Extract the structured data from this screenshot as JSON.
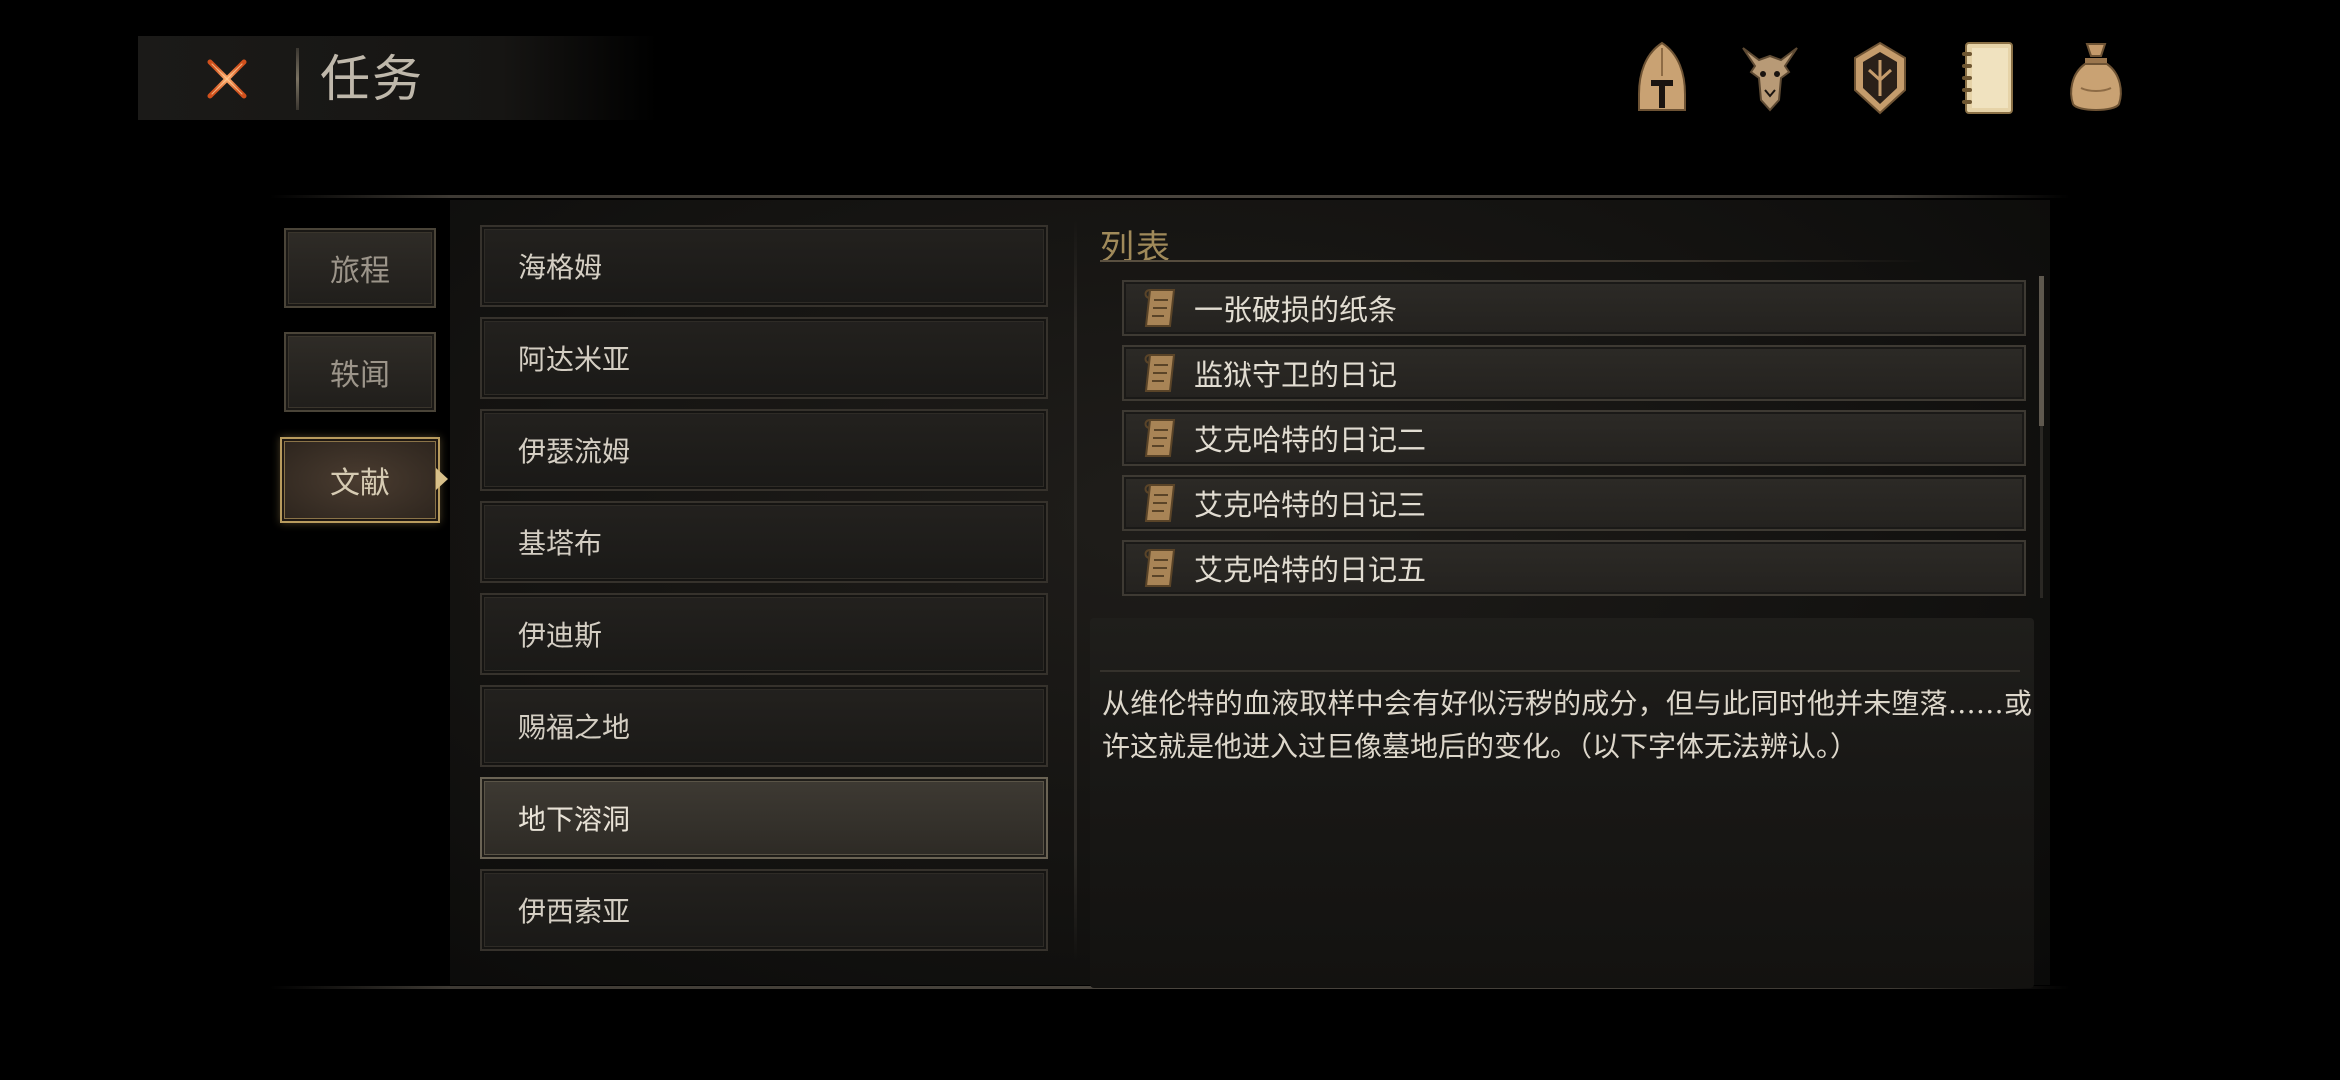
{
  "header": {
    "title": "任务",
    "close_icon": "close-x-icon",
    "accent_color": "#e0662a"
  },
  "top_icons": [
    {
      "name": "helmet-icon"
    },
    {
      "name": "beast-icon"
    },
    {
      "name": "emblem-icon"
    },
    {
      "name": "journal-icon"
    },
    {
      "name": "bag-icon"
    }
  ],
  "tabs": [
    {
      "label": "旅程"
    },
    {
      "label": "轶闻"
    },
    {
      "label": "文献",
      "active": true
    }
  ],
  "regions": [
    {
      "label": "海格姆"
    },
    {
      "label": "阿达米亚"
    },
    {
      "label": "伊瑟流姆"
    },
    {
      "label": "基塔布"
    },
    {
      "label": "伊迪斯"
    },
    {
      "label": "赐福之地"
    },
    {
      "label": "地下溶洞",
      "selected": true
    },
    {
      "label": "伊西索亚"
    }
  ],
  "detail": {
    "section_title": "列表",
    "documents": [
      {
        "label": "一张破损的纸条",
        "icon": "scroll-icon"
      },
      {
        "label": "监狱守卫的日记",
        "icon": "scroll-icon"
      },
      {
        "label": "艾克哈特的日记二",
        "icon": "scroll-icon"
      },
      {
        "label": "艾克哈特的日记三",
        "icon": "scroll-icon"
      },
      {
        "label": "艾克哈特的日记五",
        "icon": "scroll-icon"
      }
    ],
    "description": "从维伦特的血液取样中会有好似污秽的成分，但与此同时他并未堕落……或许这就是他进入过巨像墓地后的变化。（以下字体无法辨认。）"
  }
}
